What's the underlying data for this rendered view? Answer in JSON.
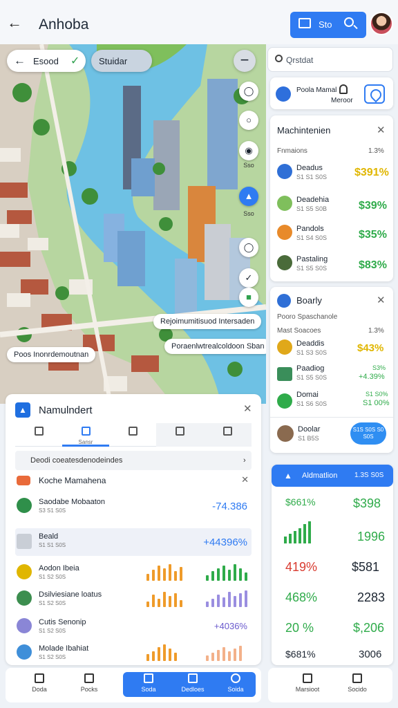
{
  "header": {
    "title": "Anhoba",
    "action_label": "Sto",
    "back_icon": "back-arrow-icon"
  },
  "map": {
    "nav_chip": "Esood",
    "filter_chip": "Stuidar",
    "rail_labels": [
      "Sso",
      "Sso"
    ],
    "tags": [
      "Rejoimumitisuod Intersaden",
      "Poraenlwtrealcoldoon Sban",
      "Poos Inonrdemoutnan"
    ]
  },
  "search": {
    "placeholder": "Qrstdat"
  },
  "tabs_card": {
    "left_label": "Poola Mamal",
    "mid_label": "Meroor"
  },
  "market": {
    "title": "Machintenien",
    "subtitle_left": "Fnmaions",
    "subtitle_right": "1.3%",
    "rows": [
      {
        "name": "Deadus",
        "sub": "S1 S1 S0S",
        "value": "$391%",
        "color": "#e0b600"
      },
      {
        "name": "Deadehia",
        "sub": "S1 S5 S0B",
        "value": "$39%",
        "color": "#2fab4a"
      },
      {
        "name": "Pandols",
        "sub": "S1 S4 S0S",
        "value": "$35%",
        "color": "#2fab4a"
      },
      {
        "name": "Pastaling",
        "sub": "S1 S5 S0S",
        "value": "$83%",
        "color": "#2fab4a"
      }
    ]
  },
  "bounty": {
    "title": "Boarly",
    "subtitle": "Pooro Spaschanole",
    "col_left": "Mast Soacoes",
    "col_right": "1.3%",
    "rows": [
      {
        "name": "Deaddis",
        "sub": "S1 S3 S0S",
        "value": "$43%",
        "color": "#e0b600"
      },
      {
        "name": "Paadiog",
        "sub": "S1 S5 S0S",
        "value_top": "S3%",
        "value": "+4.39%",
        "color": "#2fab4a"
      },
      {
        "name": "Domai",
        "sub": "S1 S6 S0S",
        "value_top": "S1 S0%",
        "value": "S1 00%",
        "color": "#2fab4a"
      }
    ],
    "footer_name": "Doolar",
    "footer_sub": "S1 B5S",
    "pill_text": "S1S S0S S0 S0S"
  },
  "performance": {
    "title": "Aldmatlion",
    "badge": "1.3S S0S",
    "rows": [
      {
        "left": "$661%",
        "right": "$398",
        "left_color": "#2fab4a",
        "right_color": "#2fab4a"
      },
      {
        "left": "",
        "right": "1996",
        "left_color": "#2fab4a",
        "right_color": "#2fab4a"
      },
      {
        "left": "419%",
        "right": "$581",
        "left_color": "#d93b30",
        "right_color": "#1b2430"
      },
      {
        "left": "468%",
        "right": "2283",
        "left_color": "#2fab4a",
        "right_color": "#1b2430"
      },
      {
        "left": "20 %",
        "right": "$,206",
        "left_color": "#2fab4a",
        "right_color": "#2fab4a"
      },
      {
        "left": "$681%",
        "right": "3006",
        "left_color": "#1b2430",
        "right_color": "#1b2430"
      }
    ]
  },
  "news": {
    "title": "Namulndert",
    "tabs": [
      "",
      "Sansr",
      "",
      "",
      ""
    ],
    "search_text": "Deodi coeatesdenodeindes",
    "section_title": "Koche Mamahena",
    "rows": [
      {
        "name": "Saodabe Mobaaton",
        "sub": "S3 S1 S0S",
        "value": "-74.386"
      },
      {
        "name": "Beald",
        "sub": "S1 S1 S0S",
        "value": "+44396%"
      },
      {
        "name": "Aodon Ibeia",
        "sub": "S1 S2 S0S",
        "value": ""
      },
      {
        "name": "Dsilviesiane loatus",
        "sub": "S1 S2 S0S",
        "value": ""
      },
      {
        "name": "Cutis Senonip",
        "sub": "S1 S2 S0S",
        "value": "+4036%"
      },
      {
        "name": "Molade Ibahiat",
        "sub": "S1 S2 S0S",
        "value": ""
      }
    ]
  },
  "bottom_nav": [
    "Doda",
    "Pocks",
    "Soda",
    "Dedloes",
    "Soida"
  ],
  "right_nav": [
    "Marsioot",
    "Socido"
  ]
}
